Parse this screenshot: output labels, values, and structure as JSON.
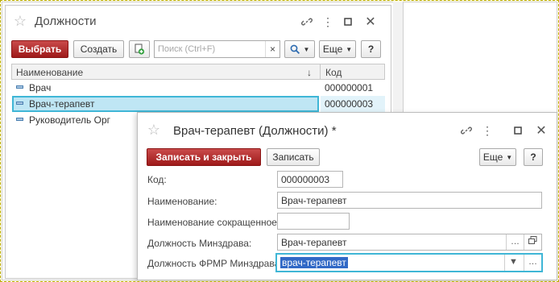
{
  "list_window": {
    "title": "Должности",
    "buttons": {
      "select": "Выбрать",
      "create": "Создать",
      "more": "Еще",
      "help": "?"
    },
    "search": {
      "placeholder": "Поиск (Ctrl+F)"
    },
    "columns": {
      "name": "Наименование",
      "sort_arrow": "↓",
      "code": "Код"
    },
    "rows": [
      {
        "name": "Врач",
        "code": "000000001"
      },
      {
        "name": "Врач-терапевт",
        "code": "000000003",
        "selected": true
      },
      {
        "name": "Руководитель Орг",
        "code": ""
      }
    ]
  },
  "edit_window": {
    "title": "Врач-терапевт (Должности) *",
    "buttons": {
      "save_close": "Записать и закрыть",
      "save": "Записать",
      "more": "Еще",
      "help": "?"
    },
    "fields": {
      "code": {
        "label": "Код:",
        "value": "000000003"
      },
      "name": {
        "label": "Наименование:",
        "value": "Врач-терапевт"
      },
      "short_name": {
        "label": "Наименование сокращенное:",
        "value": ""
      },
      "minzdrav": {
        "label": "Должность Минздрава:",
        "value": "Врач-терапевт"
      },
      "frmr": {
        "label": "Должность ФРМР Минздрава:",
        "value": "врач-терапевт"
      }
    }
  },
  "colors": {
    "primary_button": "#b02a2a",
    "selection_border": "#3fb6d6",
    "selection_fill": "#bfe6f4",
    "text_highlight": "#3169c6"
  }
}
